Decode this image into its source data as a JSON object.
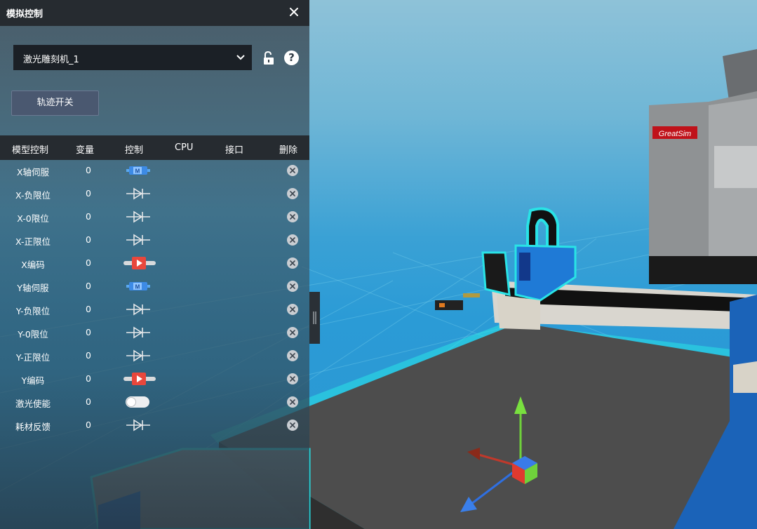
{
  "panel": {
    "title": "模拟控制",
    "device_select": {
      "value": "激光雕刻机_1"
    },
    "track_button": "轨迹开关",
    "columns": [
      "模型控制",
      "变量",
      "控制",
      "CPU",
      "接口",
      "删除"
    ],
    "rows": [
      {
        "name": "X轴伺服",
        "value": "0",
        "control": "servo-motor-icon"
      },
      {
        "name": "X-负限位",
        "value": "0",
        "control": "diode-icon"
      },
      {
        "name": "X-0限位",
        "value": "0",
        "control": "diode-icon"
      },
      {
        "name": "X-正限位",
        "value": "0",
        "control": "diode-icon"
      },
      {
        "name": "X编码",
        "value": "0",
        "control": "encoder-play-icon"
      },
      {
        "name": "Y轴伺服",
        "value": "0",
        "control": "servo-motor-icon"
      },
      {
        "name": "Y-负限位",
        "value": "0",
        "control": "diode-icon"
      },
      {
        "name": "Y-0限位",
        "value": "0",
        "control": "diode-icon"
      },
      {
        "name": "Y-正限位",
        "value": "0",
        "control": "diode-icon"
      },
      {
        "name": "Y编码",
        "value": "0",
        "control": "encoder-play-icon"
      },
      {
        "name": "激光使能",
        "value": "0",
        "control": "toggle-switch-off"
      },
      {
        "name": "耗材反馈",
        "value": "0",
        "control": "diode-icon"
      }
    ]
  },
  "scene": {
    "brand_label": "GreatSim",
    "colors": {
      "sky": "#8ec2d8",
      "floor": "#2b9bd6",
      "highlight": "#29e3e6",
      "machine_blue": "#1b63b8"
    }
  }
}
